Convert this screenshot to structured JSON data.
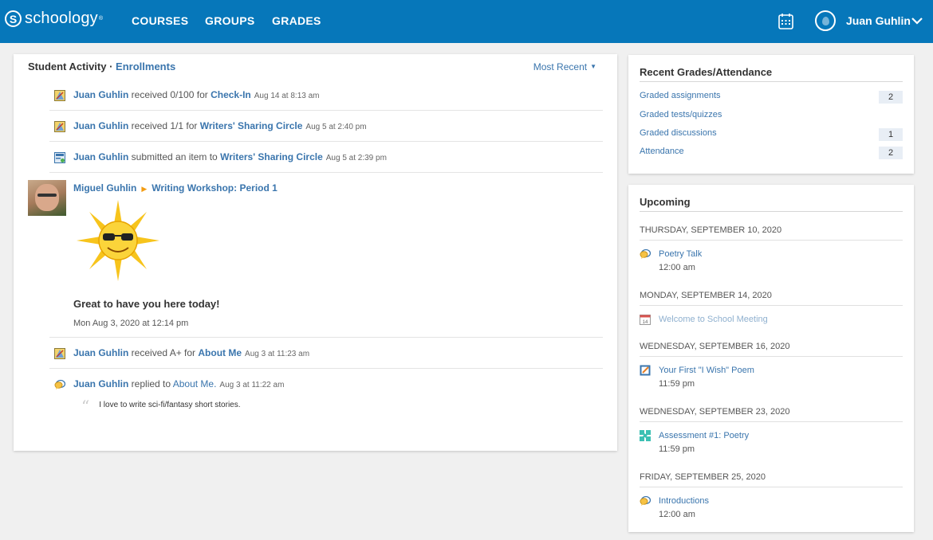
{
  "header": {
    "logo_glyph": "S",
    "logo_text": "schoology",
    "nav": [
      "COURSES",
      "GROUPS",
      "GRADES"
    ],
    "user_name": "Juan Guhlin"
  },
  "feed": {
    "title": "Student Activity ·",
    "title_link": "Enrollments",
    "sort_label": "Most Recent",
    "rows": [
      {
        "actor": "Juan Guhlin",
        "action": " received 0/100 for ",
        "target": "Check-In",
        "time": "Aug 14 at 8:13 am",
        "icon": "grade-icon"
      },
      {
        "actor": "Juan Guhlin",
        "action": " received 1/1 for ",
        "target": "Writers' Sharing Circle",
        "time": "Aug 5 at 2:40 pm",
        "icon": "grade-icon"
      },
      {
        "actor": "Juan Guhlin",
        "action": " submitted an item to ",
        "target": "Writers' Sharing Circle",
        "time": "Aug 5 at 2:39 pm",
        "icon": "submission-icon"
      }
    ],
    "post": {
      "author": "Miguel Guhlin",
      "course": "Writing Workshop: Period 1",
      "message": "Great to have you here today!",
      "date": "Mon Aug 3, 2020 at 12:14 pm"
    },
    "rows2": [
      {
        "actor": "Juan Guhlin",
        "action": " received A+ for ",
        "target": "About Me",
        "time": "Aug 3 at 11:23 am",
        "icon": "grade-icon"
      },
      {
        "actor": "Juan Guhlin",
        "action": " replied to ",
        "target": "About Me.",
        "time": "Aug 3 at 11:22 am",
        "icon": "discussion-icon"
      }
    ],
    "reply_quote": "I love to write sci-fi/fantasy short stories."
  },
  "grades": {
    "title": "Recent Grades/Attendance",
    "items": [
      {
        "label": "Graded assignments",
        "count": "2"
      },
      {
        "label": "Graded tests/quizzes",
        "count": ""
      },
      {
        "label": "Graded discussions",
        "count": "1"
      },
      {
        "label": "Attendance",
        "count": "2"
      }
    ]
  },
  "upcoming": {
    "title": "Upcoming",
    "days": [
      {
        "day": "THURSDAY, SEPTEMBER 10, 2020",
        "item": "Poetry Talk",
        "time": "12:00 am",
        "icon": "discussion-icon"
      },
      {
        "day": "MONDAY, SEPTEMBER 14, 2020",
        "item": "Welcome to School Meeting",
        "time": "",
        "icon": "calendar-event-icon"
      },
      {
        "day": "WEDNESDAY, SEPTEMBER 16, 2020",
        "item": "Your First \"I Wish\" Poem",
        "time": "11:59 pm",
        "icon": "assignment-icon"
      },
      {
        "day": "WEDNESDAY, SEPTEMBER 23, 2020",
        "item": "Assessment #1: Poetry",
        "time": "11:59 pm",
        "icon": "assessment-icon"
      },
      {
        "day": "FRIDAY, SEPTEMBER 25, 2020",
        "item": "Introductions",
        "time": "12:00 am",
        "icon": "discussion-icon"
      }
    ]
  },
  "colors": {
    "topbar": "#0677ba",
    "link": "#3a75ad",
    "background": "#f0f0f0"
  }
}
